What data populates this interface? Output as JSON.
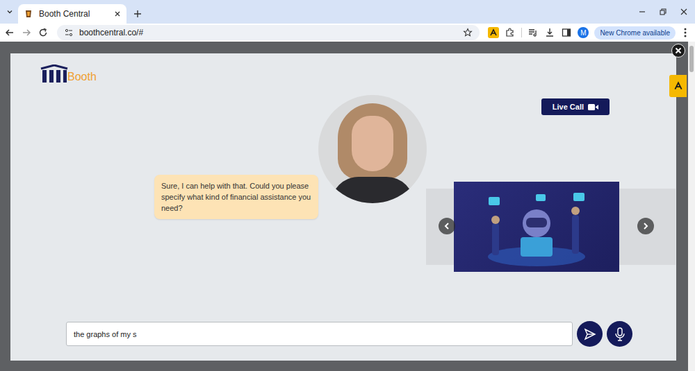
{
  "browser": {
    "tabs": [
      {
        "title": "Booth Central",
        "selected": true
      }
    ],
    "address": "boothcentral.co/#",
    "profile": "M",
    "update_button": "New Chrome available"
  },
  "modal": {
    "logo": "Booth",
    "live_call": "Live Call",
    "message": "Sure, I can help with that. Could you please specify what kind of financial assistance you need?",
    "carousel": {
      "slides": [
        {
          "selected": false
        },
        {
          "selected": true
        },
        {
          "selected": false
        }
      ]
    },
    "input": {
      "value": "the graphs of my s"
    }
  }
}
